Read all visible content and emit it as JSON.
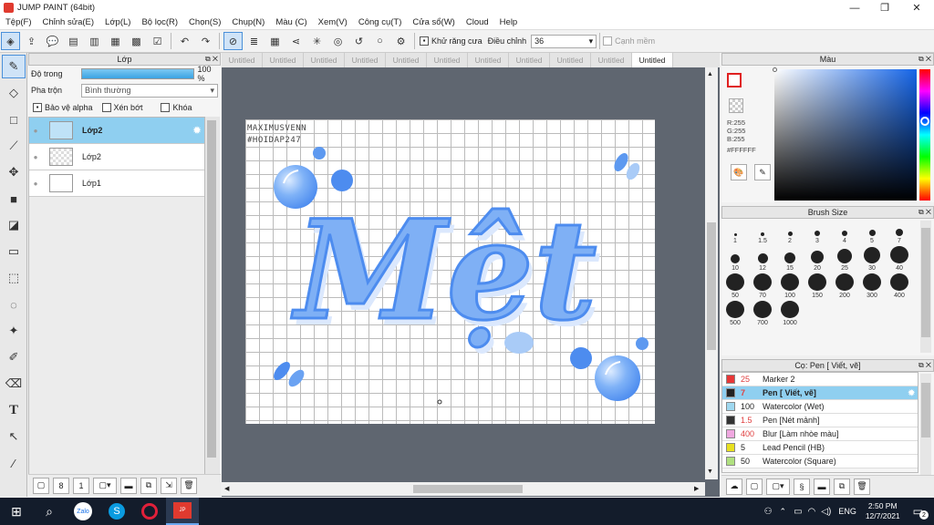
{
  "window": {
    "title": "JUMP PAINT (64bit)",
    "min": "—",
    "max": "❐",
    "close": "✕"
  },
  "menu": [
    "Tệp(F)",
    "Chỉnh sửa(E)",
    "Lớp(L)",
    "Bộ lọc(R)",
    "Chọn(S)",
    "Chụp(N)",
    "Màu (C)",
    "Xem(V)",
    "Công cụ(T)",
    "Cửa sổ(W)",
    "Cloud",
    "Help"
  ],
  "toolbar": {
    "antialias_label": "Khử răng cưa",
    "adjust_label": "Điều chỉnh",
    "adjust_value": "36",
    "sharp_label": "Cạnh mềm"
  },
  "layer_panel": {
    "title": "Lớp",
    "opacity_label": "Độ trong",
    "opacity_value": "100 %",
    "opacity_fraction": 1.0,
    "blend_label": "Pha trộn",
    "blend_value": "Bình thường",
    "protect_alpha": "Bảo vệ alpha",
    "clip": "Xén bớt",
    "lock": "Khóa",
    "layers": [
      {
        "name": "Lớp2",
        "selected": true
      },
      {
        "name": "Lớp2",
        "selected": false
      },
      {
        "name": "Lớp1",
        "selected": false
      }
    ]
  },
  "doc_tabs": [
    "Untitled",
    "Untitled",
    "Untitled",
    "Untitled",
    "Untitled",
    "Untitled",
    "Untitled",
    "Untitled",
    "Untitled",
    "Untitled",
    "Untitled"
  ],
  "active_tab_index": 10,
  "canvas": {
    "watermark_line1": "MAXIMUSVENN",
    "watermark_line2": "#HOIDAP247",
    "artwork_text": "Mệt"
  },
  "color_panel": {
    "title": "Màu",
    "r": "R:255",
    "g": "G:255",
    "b": "B:255",
    "hex": "#FFFFFF"
  },
  "brush_size_panel": {
    "title": "Brush Size",
    "sizes": [
      "1",
      "1.5",
      "2",
      "3",
      "4",
      "5",
      "7",
      "10",
      "12",
      "15",
      "20",
      "25",
      "30",
      "40",
      "50",
      "70",
      "100",
      "150",
      "200",
      "300",
      "400",
      "500",
      "700",
      "1000"
    ]
  },
  "brush_list": {
    "title": "Cọ: Pen [ Viết, vẽ]",
    "items": [
      {
        "size": "25",
        "name": "Marker 2",
        "color": "#e83838"
      },
      {
        "size": "7",
        "name": "Pen [ Viết, vẽ]",
        "color": "#222222",
        "selected": true
      },
      {
        "size": "100",
        "name": "Watercolor (Wet)",
        "color": "#9fd8f0"
      },
      {
        "size": "1.5",
        "name": "Pen [Nét mảnh]",
        "color": "#333333"
      },
      {
        "size": "400",
        "name": "Blur [Làm nhòe màu]",
        "color": "#f0a8e0"
      },
      {
        "size": "5",
        "name": "Lead Pencil (HB)",
        "color": "#e8e020"
      },
      {
        "size": "50",
        "name": "Watercolor (Square)",
        "color": "#b0e080"
      }
    ]
  },
  "taskbar": {
    "lang": "ENG",
    "time": "2:50 PM",
    "date": "12/7/2021",
    "notif_count": "2"
  }
}
